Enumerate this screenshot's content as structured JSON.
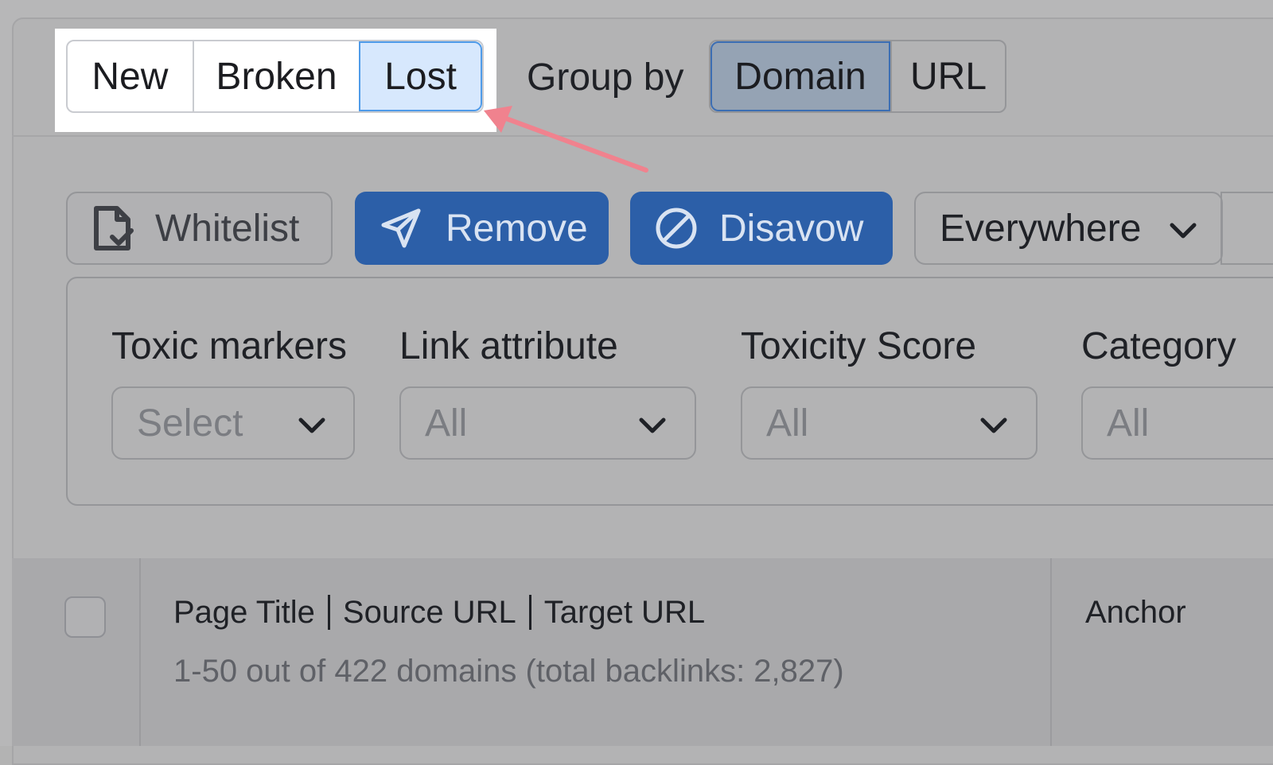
{
  "tabs": {
    "items": [
      "New",
      "Broken",
      "Lost"
    ],
    "active": "Lost"
  },
  "group_by": {
    "label": "Group by",
    "options": [
      "Domain",
      "URL"
    ],
    "active": "Domain"
  },
  "actions": {
    "whitelist": "Whitelist",
    "remove": "Remove",
    "disavow": "Disavow",
    "scope": "Everywhere"
  },
  "filters": [
    {
      "label": "Toxic markers",
      "value": "Select"
    },
    {
      "label": "Link attribute",
      "value": "All"
    },
    {
      "label": "Toxicity Score",
      "value": "All"
    },
    {
      "label": "Category",
      "value": "All"
    }
  ],
  "table": {
    "columns": [
      "Page Title",
      "Source URL",
      "Target URL"
    ],
    "summary": "1-50 out of 422 domains (total backlinks: 2,827)",
    "anchor_header": "Anchor"
  },
  "colors": {
    "primary": "#2c5fa8",
    "highlight_arrow": "#f0828e",
    "active_tab_bg": "#d7e8fd"
  }
}
